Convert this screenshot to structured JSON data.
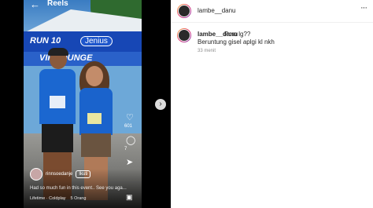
{
  "reel": {
    "header_title": "Reels",
    "banner_primary": "RUN 10",
    "banner_brand": "Jenius",
    "banner_secondary": "VIP LOUNGE",
    "likes_count": "601",
    "comments_count": "7",
    "reel_username": "rinnsoedanje",
    "follow_label": "Ikuti",
    "caption": "Had so much fun in this event.. See you aga...",
    "audio_artist": "Lifetime · Coldplay",
    "audio_people": "5 Orang"
  },
  "post": {
    "username": "lambe__danu",
    "comment": {
      "username": "lambe__danu",
      "text_line1": "Pcm lg??",
      "text_line2": "Beruntung gisel aplgi kl nkh",
      "time": "33 menit"
    }
  },
  "icons": {
    "back": "back-arrow-icon",
    "heart": "heart-icon",
    "comment": "comment-icon",
    "share": "share-icon",
    "more": "more-icon",
    "next": "chevron-right-icon"
  },
  "colors": {
    "banner_blue": "#1747b5",
    "shirt_blue": "#1b67d0",
    "text_primary": "#262626",
    "text_secondary": "#8e8e8e"
  }
}
